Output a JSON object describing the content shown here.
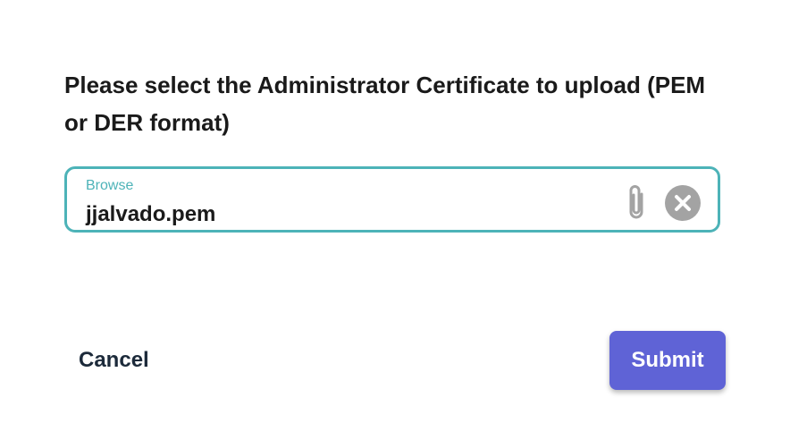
{
  "dialog": {
    "prompt": "Please select the Administrator Certificate to upload (PEM or DER format)"
  },
  "file_input": {
    "label": "Browse",
    "value": "jjalvado.pem",
    "attach_icon": "paperclip-icon",
    "clear_icon": "clear-circle-icon"
  },
  "actions": {
    "cancel_label": "Cancel",
    "submit_label": "Submit"
  },
  "colors": {
    "accent_teal": "#4db3b8",
    "submit_bg": "#5f63d6",
    "icon_gray": "#a3a3a3",
    "text_dark": "#1a1a1a"
  }
}
